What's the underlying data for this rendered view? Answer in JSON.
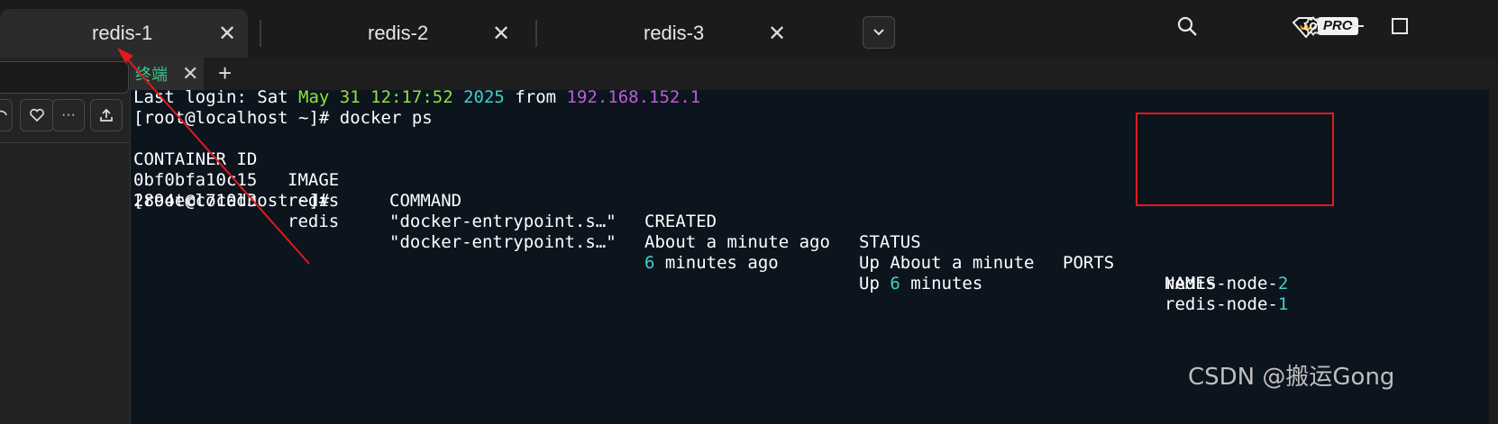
{
  "tabs": [
    {
      "label": "redis-1",
      "active": true
    },
    {
      "label": "redis-2",
      "active": false
    },
    {
      "label": "redis-3",
      "active": false
    }
  ],
  "tab_close_glyph": "✕",
  "toolbar": {
    "pro_label": "PRO",
    "icons": [
      "search-icon",
      "crown-icon",
      "gear-icon",
      "minimize-icon",
      "maximize-icon"
    ]
  },
  "terminal_tab": {
    "label": "终端",
    "close_glyph": "✕",
    "add_glyph": "+"
  },
  "left_panel": {
    "more_glyph": "···"
  },
  "terminal": {
    "login": {
      "prefix": "Last login: Sat ",
      "month_day": "May 31",
      "time": "12:17:52",
      "year": "2025",
      "from": "from",
      "ip": "192.168.152.1"
    },
    "prompt1": "[root@localhost ~]# docker ps",
    "headers": [
      "CONTAINER ID",
      "IMAGE",
      "COMMAND",
      "CREATED",
      "STATUS",
      "PORTS",
      "NAMES"
    ],
    "rows": [
      {
        "id": "0bf0bfa10c15",
        "image": "redis",
        "command": "\"docker-entrypoint.s…\"",
        "created": "About a minute ago",
        "status": "Up About a minute",
        "name_base": "redis-node-",
        "name_num": "2"
      },
      {
        "id": "2894ecc710d3",
        "image": "redis",
        "command": "\"docker-entrypoint.s…\"",
        "created_num": "6",
        "created_rest": " minutes ago",
        "status_prefix": "Up ",
        "status_num": "6",
        "status_rest": " minutes",
        "name_base": "redis-node-",
        "name_num": "1"
      }
    ],
    "prompt2": "[root@localhost ~]#"
  },
  "colors": {
    "terminal_bg": "#0c141e",
    "green": "#8fe33b",
    "cyan": "#3fd1c7",
    "purple": "#c15bd8",
    "annotation_red": "#e5191b"
  },
  "watermark": "CSDN @搬运Gong"
}
